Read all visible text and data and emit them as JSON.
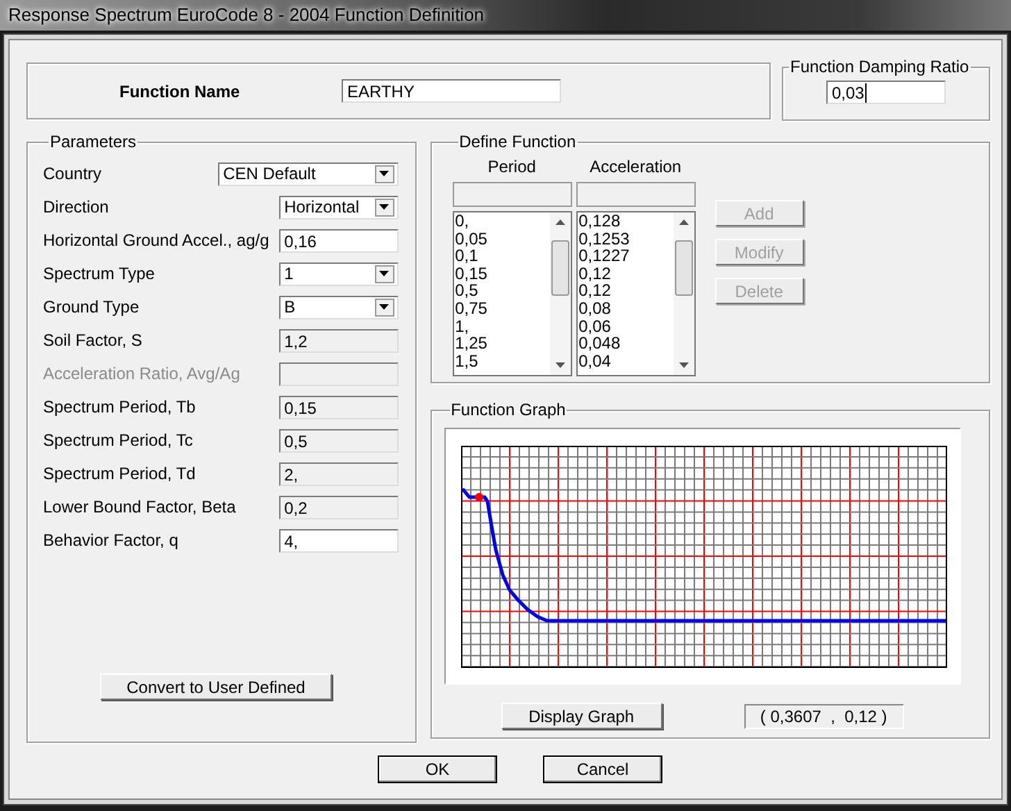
{
  "window": {
    "title": "Response Spectrum EuroCode 8 - 2004 Function Definition"
  },
  "function_name": {
    "label": "Function Name",
    "value": "EARTHY"
  },
  "damping": {
    "title": "Function Damping Ratio",
    "value": "0,03"
  },
  "parameters": {
    "title": "Parameters",
    "fields": [
      {
        "label": "Country",
        "kind": "dropdown",
        "value": "CEN Default",
        "disabled": false
      },
      {
        "label": "Direction",
        "kind": "dropdown",
        "value": "Horizontal",
        "disabled": false
      },
      {
        "label": "Horizontal Ground Accel.,  ag/g",
        "kind": "input",
        "value": "0,16",
        "disabled": false
      },
      {
        "label": "Spectrum Type",
        "kind": "dropdown",
        "value": "1",
        "disabled": false
      },
      {
        "label": "Ground Type",
        "kind": "dropdown",
        "value": "B",
        "disabled": false
      },
      {
        "label": "Soil Factor, S",
        "kind": "readonly",
        "value": "1,2",
        "disabled": false
      },
      {
        "label": "Acceleration Ratio,  Avg/Ag",
        "kind": "readonly",
        "disabled": true
      },
      {
        "label": "Spectrum Period, Tb",
        "kind": "readonly",
        "value": "0,15",
        "disabled": false
      },
      {
        "label": "Spectrum Period, Tc",
        "kind": "readonly",
        "value": "0,5",
        "disabled": false
      },
      {
        "label": "Spectrum Period, Td",
        "kind": "readonly",
        "value": "2,",
        "disabled": false
      },
      {
        "label": "Lower Bound Factor, Beta",
        "kind": "readonly",
        "value": "0,2",
        "disabled": false
      },
      {
        "label": "Behavior Factor, q",
        "kind": "input",
        "value": "4,",
        "disabled": false
      }
    ],
    "button": "Convert to User Defined"
  },
  "define_function": {
    "title": "Define Function",
    "columns": [
      {
        "header": "Period",
        "items": [
          "0,",
          "0,05",
          "0,1",
          "0,15",
          "0,5",
          "0,75",
          "1,",
          "1,25",
          "1,5"
        ]
      },
      {
        "header": "Acceleration",
        "items": [
          "0,128",
          "0,1253",
          "0,1227",
          "0,12",
          "0,12",
          "0,08",
          "0,06",
          "0,048",
          "0,04"
        ]
      }
    ],
    "buttons": [
      {
        "label": "Add",
        "disabled": true
      },
      {
        "label": "Modify",
        "disabled": true
      },
      {
        "label": "Delete",
        "disabled": true
      }
    ]
  },
  "function_graph": {
    "title": "Function Graph",
    "button": "Display Graph",
    "readout": "( 0,3607  ,  0,12 )"
  },
  "buttons": [
    "OK",
    "Cancel"
  ]
}
